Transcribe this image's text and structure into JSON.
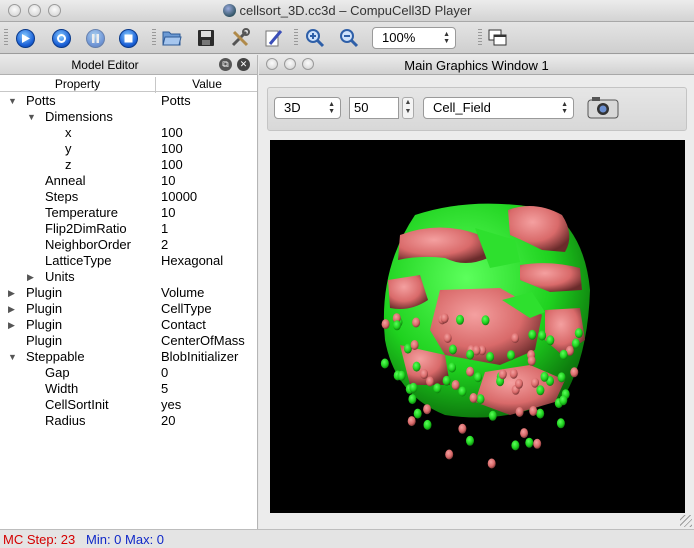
{
  "window": {
    "title": "cellsort_3D.cc3d – CompuCell3D Player"
  },
  "toolbar": {
    "zoom_value": "100%",
    "buttons": [
      "run-icon",
      "step-icon",
      "pause-icon",
      "stop-icon",
      "open-icon",
      "save-icon",
      "tools-icon",
      "edit-icon",
      "zoom-in-icon",
      "zoom-out-icon",
      "new-window-icon"
    ]
  },
  "model_editor": {
    "title": "Model Editor",
    "col_property": "Property",
    "col_value": "Value",
    "rows": [
      {
        "property": "Potts",
        "value": "Potts",
        "level": 0,
        "expander": "▼"
      },
      {
        "property": "Dimensions",
        "value": "",
        "level": 1,
        "expander": "▼"
      },
      {
        "property": "x",
        "value": "100",
        "level": 2,
        "expander": ""
      },
      {
        "property": "y",
        "value": "100",
        "level": 2,
        "expander": ""
      },
      {
        "property": "z",
        "value": "100",
        "level": 2,
        "expander": ""
      },
      {
        "property": "Anneal",
        "value": "10",
        "level": 1,
        "expander": ""
      },
      {
        "property": "Steps",
        "value": "10000",
        "level": 1,
        "expander": ""
      },
      {
        "property": "Temperature",
        "value": "10",
        "level": 1,
        "expander": ""
      },
      {
        "property": "Flip2DimRatio",
        "value": "1",
        "level": 1,
        "expander": ""
      },
      {
        "property": "NeighborOrder",
        "value": "2",
        "level": 1,
        "expander": ""
      },
      {
        "property": "LatticeType",
        "value": "Hexagonal",
        "level": 1,
        "expander": ""
      },
      {
        "property": "Units",
        "value": "",
        "level": 1,
        "expander": "▶"
      },
      {
        "property": "Plugin",
        "value": "Volume",
        "level": 0,
        "expander": "▶"
      },
      {
        "property": "Plugin",
        "value": "CellType",
        "level": 0,
        "expander": "▶"
      },
      {
        "property": "Plugin",
        "value": "Contact",
        "level": 0,
        "expander": "▶"
      },
      {
        "property": "Plugin",
        "value": "CenterOfMass",
        "level": 0,
        "expander": ""
      },
      {
        "property": "Steppable",
        "value": "BlobInitializer",
        "level": 0,
        "expander": "▼"
      },
      {
        "property": "Gap",
        "value": "0",
        "level": 1,
        "expander": ""
      },
      {
        "property": "Width",
        "value": "5",
        "level": 1,
        "expander": ""
      },
      {
        "property": "CellSortInit",
        "value": "yes",
        "level": 1,
        "expander": ""
      },
      {
        "property": "Radius",
        "value": "20",
        "level": 1,
        "expander": ""
      }
    ]
  },
  "graphics": {
    "title": "Main Graphics Window 1",
    "view_mode": "3D",
    "slice_value": "50",
    "field": "Cell_Field",
    "colors": {
      "green": "#1fd21f",
      "red": "#d96a6a",
      "background": "#000000"
    }
  },
  "status": {
    "mc_step": "MC Step: 23",
    "min_max": "Min: 0 Max: 0"
  }
}
